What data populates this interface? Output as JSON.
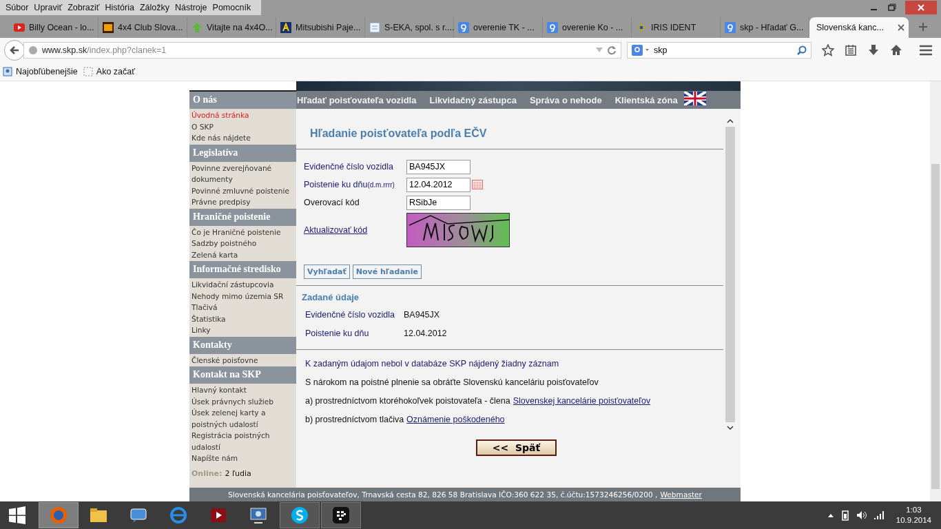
{
  "menu_bar": [
    "Súbor",
    "Upraviť",
    "Zobraziť",
    "História",
    "Záložky",
    "Nástroje",
    "Pomocník"
  ],
  "tabs": [
    {
      "label": "Billy Ocean - lo...",
      "selected": false
    },
    {
      "label": "4x4 Club Slova...",
      "selected": false
    },
    {
      "label": "Vitajte na 4x4O...",
      "selected": false
    },
    {
      "label": "Mitsubishi Paje...",
      "selected": false
    },
    {
      "label": "S-EKA, spol. s r....",
      "selected": false
    },
    {
      "label": "overenie TK - ...",
      "selected": false
    },
    {
      "label": "overenie Ko - ...",
      "selected": false
    },
    {
      "label": "IRIS IDENT",
      "selected": false
    },
    {
      "label": "skp - Hľadať G...",
      "selected": false
    },
    {
      "label": "Slovenská kanc...",
      "selected": true
    }
  ],
  "address_bar": {
    "host": "www.skp.sk",
    "path": "/index.php?clanek=1"
  },
  "search_bar": {
    "value": "skp"
  },
  "bookmarks": [
    "Najobľúbenejšie",
    "Ako začať"
  ],
  "site": {
    "nav": [
      "Hľadať poisťovateľa vozidla",
      "Likvidačný zástupca",
      "Správa o nehode",
      "Klientská zóna"
    ],
    "sidebar": [
      {
        "heading": "O nás",
        "items": [
          {
            "label": "Úvodná stránka",
            "selected": true
          },
          {
            "label": "O SKP",
            "selected": false
          },
          {
            "label": "Kde nás nájdete",
            "selected": false
          }
        ]
      },
      {
        "heading": "Legislatíva",
        "items": [
          {
            "label": "Povinne zverejňované dokumenty",
            "selected": false
          },
          {
            "label": "Povinné zmluvné poistenie",
            "selected": false
          },
          {
            "label": "Právne predpisy",
            "selected": false
          }
        ]
      },
      {
        "heading": "Hraničné poistenie",
        "items": [
          {
            "label": "Čo je Hraničné poistenie",
            "selected": false
          },
          {
            "label": "Sadzby poistného",
            "selected": false
          },
          {
            "label": "Zelená karta",
            "selected": false
          }
        ]
      },
      {
        "heading": "Informačné stredisko",
        "items": [
          {
            "label": "Likvidační zástupcovia",
            "selected": false
          },
          {
            "label": "Nehody mimo územia SR",
            "selected": false
          },
          {
            "label": "Tlačivá",
            "selected": false
          },
          {
            "label": "Štatistika",
            "selected": false
          },
          {
            "label": "Linky",
            "selected": false
          }
        ]
      },
      {
        "heading": "Kontakty",
        "items": [
          {
            "label": "Členské poisťovne",
            "selected": false
          }
        ]
      },
      {
        "heading": "Kontakt na SKP",
        "items": [
          {
            "label": "Hlavný kontakt",
            "selected": false
          },
          {
            "label": "Úsek právnych služieb",
            "selected": false
          },
          {
            "label": "Úsek zelenej karty a poistných udalostí",
            "selected": false
          },
          {
            "label": "Registrácia poistných udalostí",
            "selected": false
          },
          {
            "label": "Napíšte nám",
            "selected": false
          }
        ]
      }
    ],
    "online": {
      "label": "Online:",
      "value": "2 ľudia"
    },
    "form": {
      "title": "Hľadanie poisťovateľa podľa EČV",
      "fields": [
        {
          "label": "Evidenčné číslo vozidla",
          "value": "BA945JX",
          "kind": "text"
        },
        {
          "label": "Poistenie ku dňu",
          "hint": "(d.m.rrrr)",
          "value": "12.04.2012",
          "kind": "date"
        },
        {
          "label": "Overovací kód",
          "value": "RSibJe",
          "kind": "text"
        }
      ],
      "refresh_link": "Aktualizovať kód",
      "buttons": [
        "Vyhľadať",
        "Nové hľadanie"
      ]
    },
    "summary": {
      "heading": "Zadané údaje",
      "rows": [
        {
          "label": "Evidenčné číslo vozidla",
          "value": "BA945JX"
        },
        {
          "label": "Poistenie ku dňu",
          "value": "12.04.2012"
        }
      ]
    },
    "result": {
      "notice": "K zadaným údajom nebol v databáze SKP nájdený žiadny záznam",
      "lines": [
        {
          "text": "S nárokom na poistné plnenie sa obráťte Slovenskú kanceláriu poisťovateľov"
        },
        {
          "text": "a) prostredníctvom ktoréhokoľvek poistovateľa - člena",
          "link": "Slovenskej kancelárie poisťovateľov"
        },
        {
          "text": "b) prostredníctvom tlačiva",
          "link": "Oznámenie poškodeného"
        }
      ]
    },
    "back_button": "<<  Späť",
    "footer": {
      "text": "Slovenská kancelária poisťovateľov, Trnavská cesta 82, 826 58 Bratislava IČO:360 622 35, č.účtu:1573246256/0200 ,",
      "link": "Webmaster"
    }
  },
  "taskbar": {
    "time": "1:03",
    "date": "10.9.2014"
  }
}
